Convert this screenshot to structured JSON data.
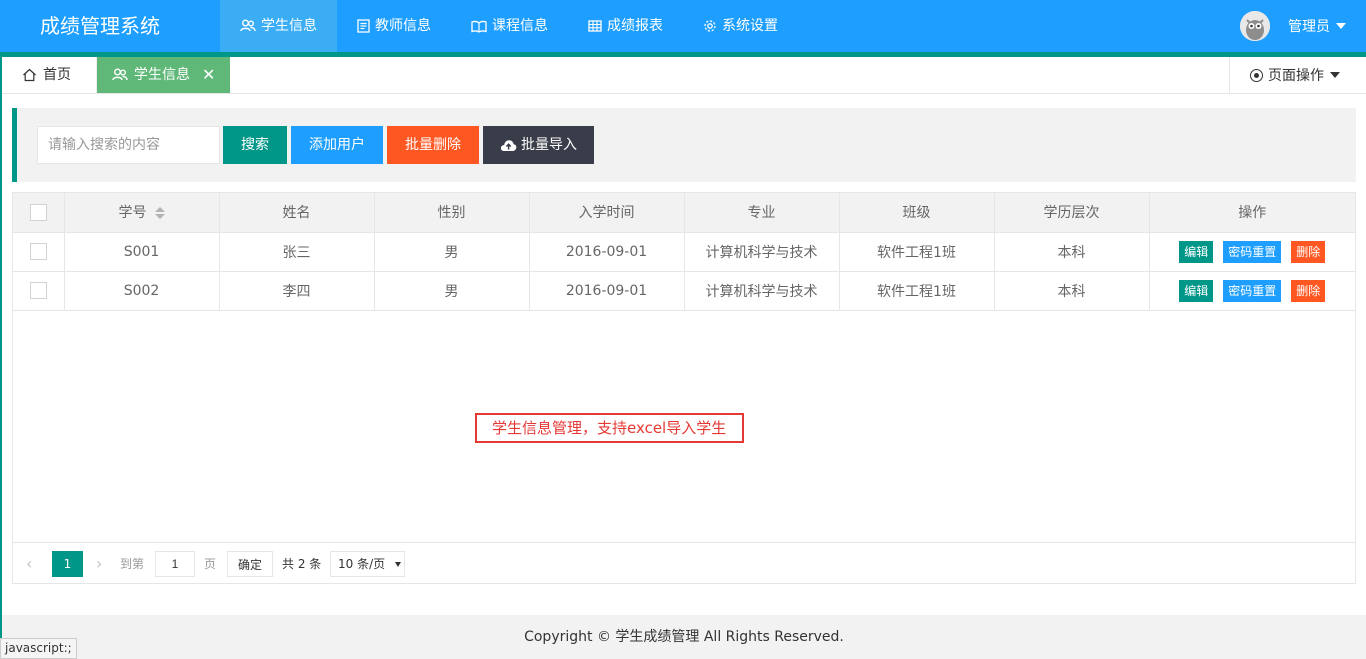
{
  "app": {
    "title": "成绩管理系统"
  },
  "nav": [
    {
      "label": "学生信息",
      "icon": "users-icon",
      "active": true
    },
    {
      "label": "教师信息",
      "icon": "document-icon",
      "active": false
    },
    {
      "label": "课程信息",
      "icon": "book-icon",
      "active": false
    },
    {
      "label": "成绩报表",
      "icon": "table-icon",
      "active": false
    },
    {
      "label": "系统设置",
      "icon": "gear-icon",
      "active": false
    }
  ],
  "user": {
    "name": "管理员"
  },
  "tabs": {
    "home": "首页",
    "current": "学生信息",
    "page_ops": "页面操作"
  },
  "toolbar": {
    "search_placeholder": "请输入搜索的内容",
    "search_value": "",
    "search_label": "搜索",
    "add_label": "添加用户",
    "batch_delete_label": "批量删除",
    "batch_import_label": "批量导入"
  },
  "table": {
    "headers": [
      "学号",
      "姓名",
      "性别",
      "入学时间",
      "专业",
      "班级",
      "学历层次",
      "操作"
    ],
    "rows": [
      {
        "id": "S001",
        "name": "张三",
        "gender": "男",
        "date": "2016-09-01",
        "major": "计算机科学与技术",
        "class": "软件工程1班",
        "level": "本科"
      },
      {
        "id": "S002",
        "name": "李四",
        "gender": "男",
        "date": "2016-09-01",
        "major": "计算机科学与技术",
        "class": "软件工程1班",
        "level": "本科"
      }
    ],
    "actions": {
      "edit": "编辑",
      "reset": "密码重置",
      "delete": "删除"
    }
  },
  "annotation": "学生信息管理，支持excel导入学生",
  "pager": {
    "prev": "‹",
    "current": "1",
    "next": "›",
    "goto_label": "到第",
    "goto_value": "1",
    "page_unit": "页",
    "confirm": "确定",
    "total": "共 2 条",
    "page_size": "10 条/页"
  },
  "footer": "Copyright © 学生成绩管理 All Rights Reserved.",
  "status_url": "javascript:;",
  "colors": {
    "primary": "#1E9FFF",
    "green": "#009688",
    "tab_active": "#5FB878",
    "danger": "#FF5722",
    "dark": "#393D49"
  }
}
